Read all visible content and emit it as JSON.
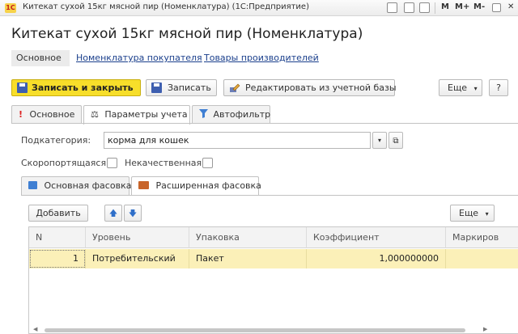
{
  "window": {
    "title": "Китекат сухой 15кг мясной пир (Номенклатура) (1С:Предприятие)",
    "logo_text": "1С",
    "tools": [
      "M",
      "M+",
      "M-"
    ]
  },
  "form": {
    "title": "Китекат сухой 15кг мясной пир (Номенклатура)"
  },
  "nav": {
    "items": [
      "Основное",
      "Номенклатура покупателя",
      "Товары производителей"
    ]
  },
  "toolbar": {
    "save_close": "Записать и закрыть",
    "save": "Записать",
    "edit": "Редактировать из учетной базы",
    "more": "Еще",
    "help": "?"
  },
  "tabs": [
    {
      "label": "Основное",
      "icon": "exclamation-icon"
    },
    {
      "label": "Параметры учета",
      "icon": "scales-icon"
    },
    {
      "label": "Автофильтр",
      "icon": "funnel-icon"
    }
  ],
  "fields": {
    "subcategory_label": "Подкатегория:",
    "subcategory_value": "корма для кошек",
    "perishable_label": "Скоропортящаяся:",
    "substandard_label": "Некачественная:"
  },
  "subtabs": [
    {
      "label": "Основная фасовка",
      "icon": "box-icon"
    },
    {
      "label": "Расширенная фасовка",
      "icon": "boxes-icon"
    }
  ],
  "table_toolbar": {
    "add": "Добавить",
    "more": "Еще"
  },
  "table": {
    "columns": [
      "N",
      "Уровень",
      "Упаковка",
      "Коэффициент",
      "Маркиров"
    ],
    "rows": [
      [
        "1",
        "Потребительский",
        "Пакет",
        "1,000000000",
        ""
      ]
    ]
  },
  "colors": {
    "primary_button": "#f7de2a",
    "selected_row": "#fbf0b8",
    "link": "#1a3f8c"
  }
}
